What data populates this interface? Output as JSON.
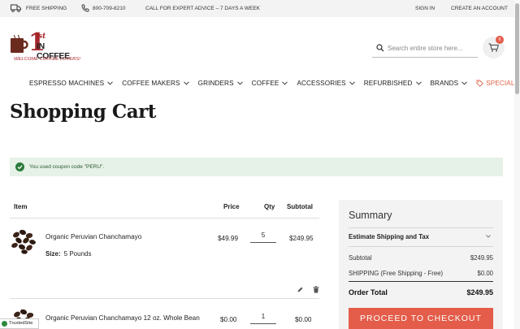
{
  "topbar": {
    "free_shipping": "FREE SHIPPING",
    "phone": "800-709-8210",
    "advice": "CALL FOR EXPERT ADVICE – 7 DAYS A WEEK",
    "sign_in": "SIGN IN",
    "create_account": "CREATE AN ACCOUNT"
  },
  "header": {
    "logo_one": "1",
    "logo_st": "st",
    "logo_brand": "IN COFFEE",
    "logo_tagline": "WELCOME COFFEE LOVERS!",
    "search_placeholder": "Search entire store here...",
    "cart_count": "6"
  },
  "nav": [
    {
      "label": "ESPRESSO MACHINES"
    },
    {
      "label": "COFFEE MAKERS"
    },
    {
      "label": "GRINDERS"
    },
    {
      "label": "COFFEE"
    },
    {
      "label": "ACCESSORIES"
    },
    {
      "label": "REFURBISHED"
    },
    {
      "label": "BRANDS"
    },
    {
      "label": "SPECIALS"
    }
  ],
  "page_title": "Shopping Cart",
  "message": "You used coupon code \"PERU\".",
  "table": {
    "headers": {
      "item": "Item",
      "price": "Price",
      "qty": "Qty",
      "subtotal": "Subtotal"
    },
    "rows": [
      {
        "name": "Organic Peruvian Chanchamayo",
        "size_label": "Size:",
        "size_value": "5 Pounds",
        "price": "$49.99",
        "qty": "5",
        "subtotal": "$249.95"
      },
      {
        "name": "Organic Peruvian Chanchamayo 12 oz. Whole Bean",
        "price": "$0.00",
        "qty": "1",
        "subtotal": "$0.00"
      }
    ]
  },
  "summary": {
    "title": "Summary",
    "estimate": "Estimate Shipping and Tax",
    "subtotal_label": "Subtotal",
    "subtotal_value": "$249.95",
    "shipping_label": "SHIPPING (Free Shipping - Free)",
    "shipping_value": "$0.00",
    "total_label": "Order Total",
    "total_value": "$249.95",
    "checkout": "PROCEED TO CHECKOUT"
  },
  "trusted": "TrustedSite",
  "colors": {
    "accent": "#e35d4a",
    "brand_red": "#a6262b",
    "success_bg": "#e6f1e7",
    "success_icon": "#2a7a3a"
  }
}
